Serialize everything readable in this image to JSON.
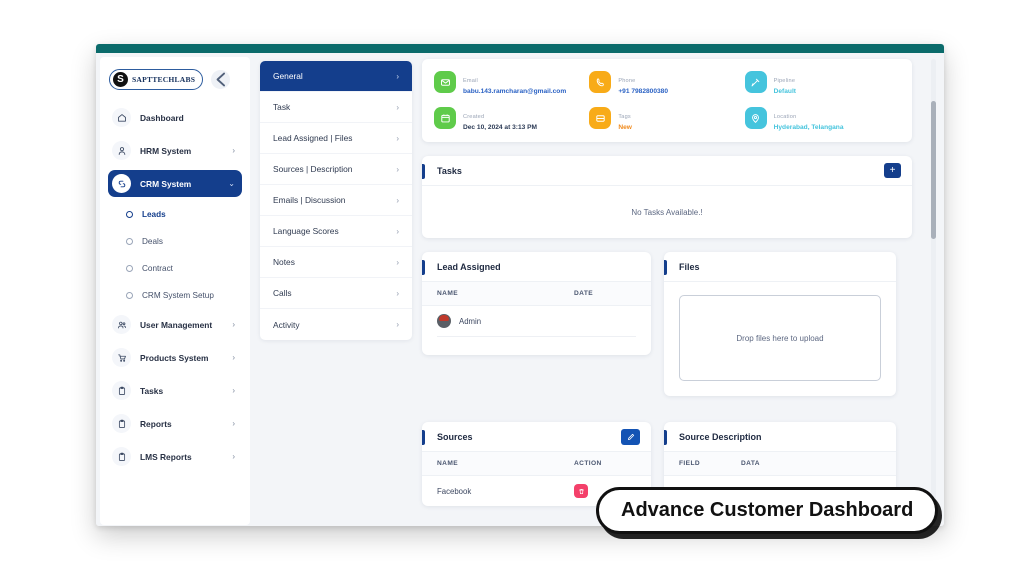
{
  "brand": {
    "name": "SAPTTECHLABS",
    "mark": "S",
    "back_icon": "arrow-left-icon"
  },
  "theme": {
    "topbar": "#0b6b6b",
    "primary": "#143e8c",
    "accent_blue": "#1353b4",
    "danger": "#f4406a",
    "green": "#5fcb4a",
    "orange": "#f8ab18",
    "cyan": "#45c4dd"
  },
  "sidebar": {
    "items": [
      {
        "label": "Dashboard",
        "icon": "home-icon",
        "caret": "",
        "active": false
      },
      {
        "label": "HRM System",
        "icon": "user-icon",
        "caret": "›",
        "active": false
      },
      {
        "label": "CRM System",
        "icon": "crm-icon",
        "caret": "⌄",
        "active": true
      }
    ],
    "sub_items": [
      {
        "label": "Leads",
        "selected": true
      },
      {
        "label": "Deals",
        "selected": false
      },
      {
        "label": "Contract",
        "selected": false
      },
      {
        "label": "CRM System Setup",
        "selected": false
      }
    ],
    "items_after": [
      {
        "label": "User Management",
        "icon": "users-icon",
        "caret": "›"
      },
      {
        "label": "Products System",
        "icon": "cart-icon",
        "caret": "›"
      },
      {
        "label": "Tasks",
        "icon": "clipboard-icon",
        "caret": "›"
      },
      {
        "label": "Reports",
        "icon": "clipboard-icon",
        "caret": "›"
      },
      {
        "label": "LMS Reports",
        "icon": "clipboard-icon",
        "caret": "›"
      }
    ]
  },
  "subnav": {
    "items": [
      {
        "label": "General",
        "active": true
      },
      {
        "label": "Task",
        "active": false
      },
      {
        "label": "Lead Assigned | Files",
        "active": false
      },
      {
        "label": "Sources | Description",
        "active": false
      },
      {
        "label": "Emails | Discussion",
        "active": false
      },
      {
        "label": "Language Scores",
        "active": false
      },
      {
        "label": "Notes",
        "active": false
      },
      {
        "label": "Calls",
        "active": false
      },
      {
        "label": "Activity",
        "active": false
      }
    ],
    "caret": "›"
  },
  "info": {
    "cells": [
      {
        "label": "Email",
        "value": "babu.143.ramcharan@gmail.com",
        "icon": "mail-icon",
        "color": "green",
        "value_color": "v-blue"
      },
      {
        "label": "Phone",
        "value": "+91 7982800380",
        "icon": "phone-icon",
        "color": "orange",
        "value_color": "v-blue"
      },
      {
        "label": "Pipeline",
        "value": "Default",
        "icon": "pipeline-icon",
        "color": "cyan",
        "value_color": "v-cyan"
      },
      {
        "label": "Created",
        "value": "Dec 10, 2024 at 3:13 PM",
        "icon": "calendar-icon",
        "color": "green",
        "value_color": "v-dark"
      },
      {
        "label": "Tags",
        "value": "New",
        "icon": "tag-icon",
        "color": "orange",
        "value_color": "v-orange"
      },
      {
        "label": "Location",
        "value": "Hyderabad, Telangana",
        "icon": "location-icon",
        "color": "cyan",
        "value_color": "v-cyan"
      }
    ]
  },
  "tasks": {
    "title": "Tasks",
    "add_label": "+",
    "empty_text": "No Tasks Available.!"
  },
  "lead_assigned": {
    "title": "Lead Assigned",
    "columns": {
      "name": "NAME",
      "date": "DATE"
    },
    "rows": [
      {
        "name": "Admin",
        "date": ""
      }
    ]
  },
  "files": {
    "title": "Files",
    "dropzone_text": "Drop files here to upload"
  },
  "sources": {
    "title": "Sources",
    "edit_icon": "pencil-icon",
    "columns": {
      "name": "NAME",
      "action": "ACTION"
    },
    "rows": [
      {
        "name": "Facebook",
        "action_icon": "trash-icon"
      }
    ]
  },
  "source_description": {
    "title": "Source Description",
    "columns": {
      "field": "FIELD",
      "data": "DATA"
    },
    "rows": []
  },
  "caption": {
    "text": "Advance Customer Dashboard"
  }
}
